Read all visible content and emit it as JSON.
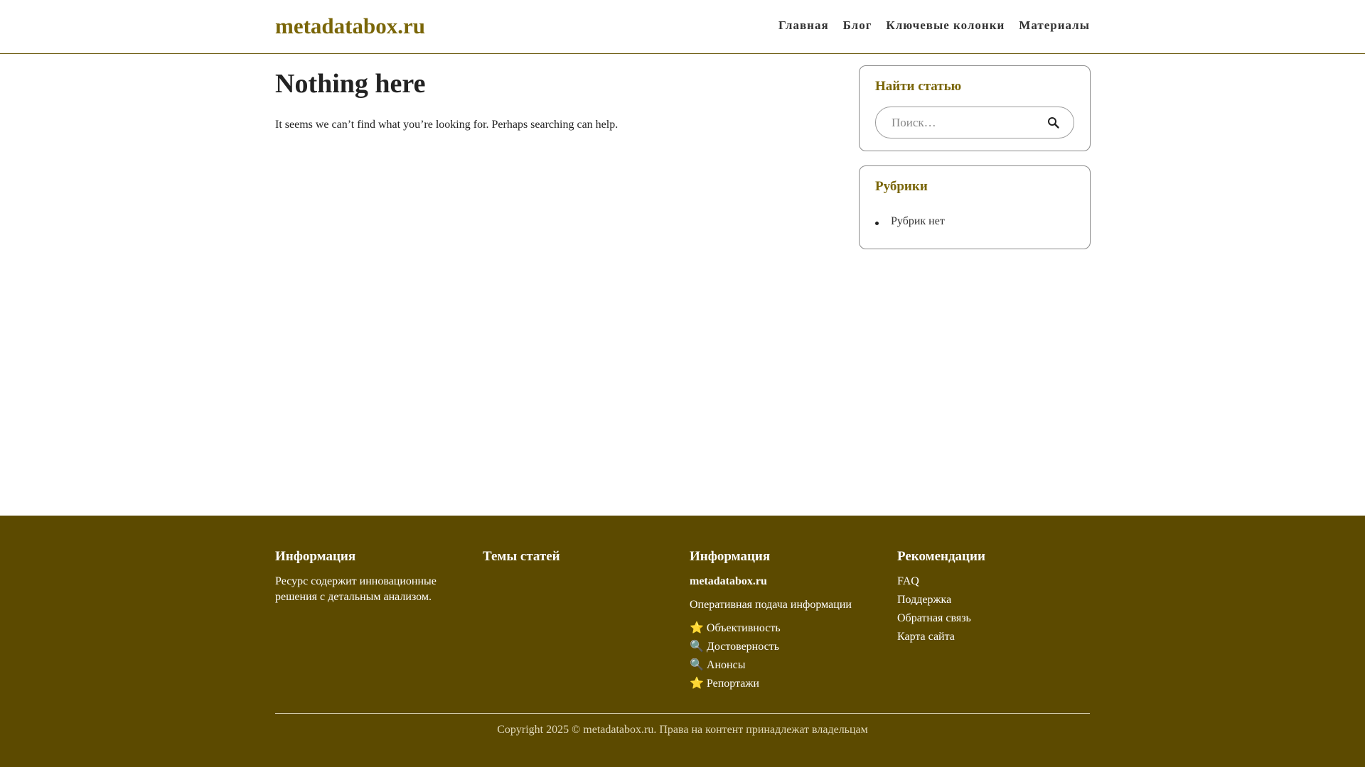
{
  "header": {
    "site_title": "metadatabox.ru",
    "nav": [
      "Главная",
      "Блог",
      "Ключевые колонки",
      "Материалы"
    ]
  },
  "main": {
    "title": "Nothing here",
    "text": "It seems we can’t find what you’re looking for. Perhaps searching can help."
  },
  "sidebar": {
    "search_title": "Найти статью",
    "search_placeholder": "Поиск…",
    "categories_title": "Рубрики",
    "categories": [
      "Рубрик нет"
    ]
  },
  "footer": {
    "col1": {
      "title": "Информация",
      "text": "Ресурс содержит инновационные решения с детальным анализом."
    },
    "col2": {
      "title": "Темы статей"
    },
    "col3": {
      "title": "Информация",
      "site": "metadatabox.ru",
      "tagline": "Оперативная подача информации",
      "items": [
        "⭐ Объективность",
        "🔍 Достоверность",
        "🔍 Анонсы",
        "⭐ Репортажи"
      ]
    },
    "col4": {
      "title": "Рекомендации",
      "links": [
        "FAQ",
        "Поддержка",
        "Обратная связь",
        "Карта сайта"
      ]
    },
    "copyright": "Copyright 2025 © metadatabox.ru. Права на контент принадлежат владельцам"
  },
  "colors": {
    "accent": "#7a6608",
    "footer_bg": "#5c4a00"
  },
  "icons": {
    "search": "search-icon"
  }
}
